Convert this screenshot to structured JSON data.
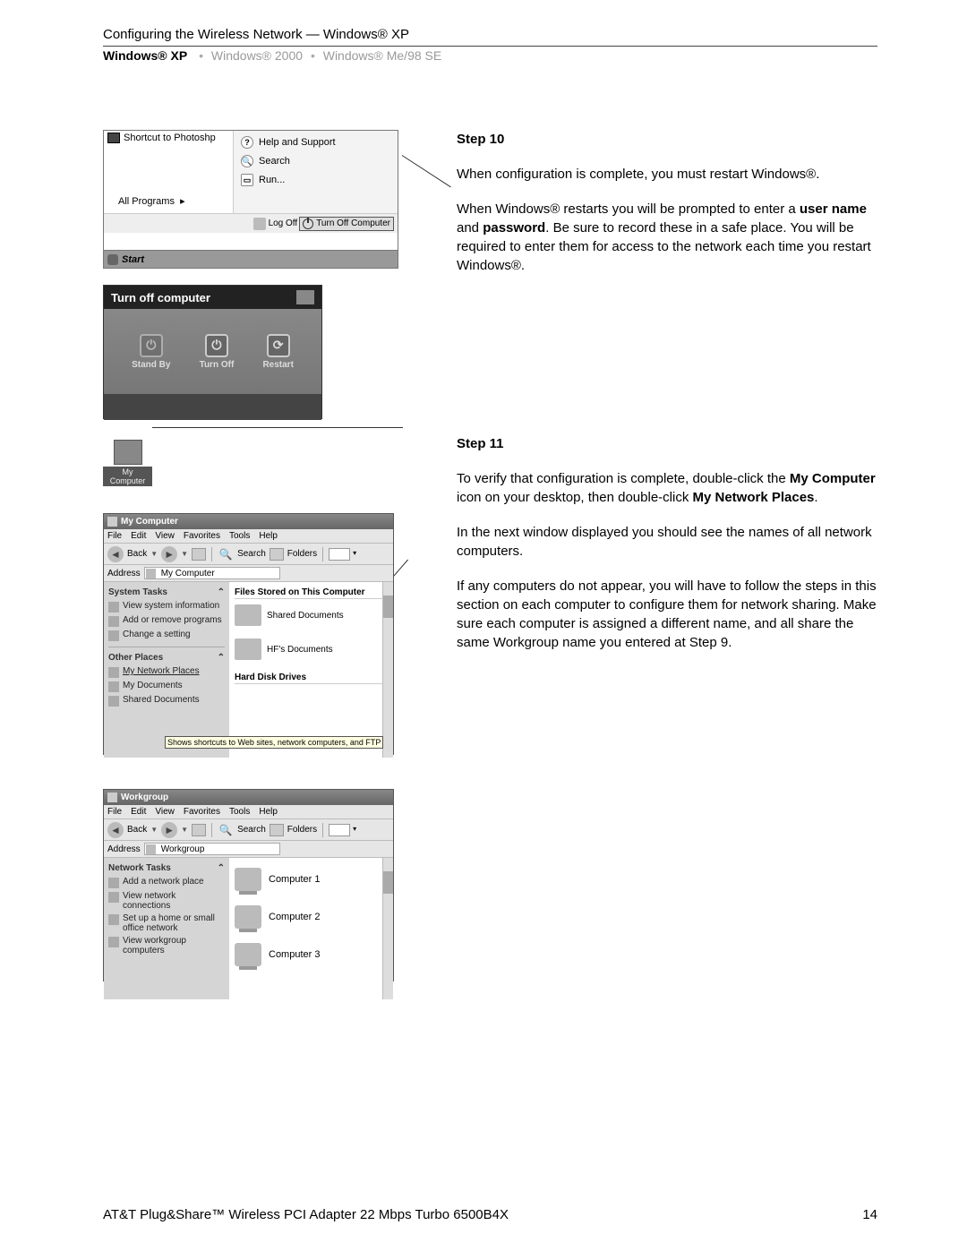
{
  "header": {
    "title": "Configuring the Wireless Network — Windows® XP",
    "os": [
      "Windows® XP",
      "Windows® 2000",
      "Windows® Me/98 SE"
    ]
  },
  "footer": {
    "left": "AT&T Plug&Share™ Wireless PCI Adapter 22 Mbps Turbo 6500B4X",
    "right": "14"
  },
  "shot1": {
    "shortcut": "Shortcut to Photoshp",
    "allprograms": "All Programs",
    "help": "Help and Support",
    "search": "Search",
    "run": "Run...",
    "logoff": "Log Off",
    "turnoff": "Turn Off Computer",
    "start": "Start"
  },
  "shot2": {
    "title": "Turn off computer",
    "standby": "Stand By",
    "turnoff": "Turn Off",
    "restart": "Restart"
  },
  "shot3": {
    "label": "My Computer"
  },
  "shot4": {
    "title": "My Computer",
    "menus": [
      "File",
      "Edit",
      "View",
      "Favorites",
      "Tools",
      "Help"
    ],
    "back": "Back",
    "search": "Search",
    "folders": "Folders",
    "addressLabel": "Address",
    "addressValue": "My Computer",
    "systemTasks": "System Tasks",
    "st": [
      "View system information",
      "Add or remove programs",
      "Change a setting"
    ],
    "otherPlaces": "Other Places",
    "op": [
      "My Network Places",
      "My Documents",
      "Shared Documents"
    ],
    "filesHeader": "Files Stored on This Computer",
    "sharedDocs": "Shared Documents",
    "hfDocs": "HF's Documents",
    "hddHeader": "Hard Disk Drives",
    "tooltip": "Shows shortcuts to Web sites, network computers, and FTP"
  },
  "shot5": {
    "title": "Workgroup",
    "menus": [
      "File",
      "Edit",
      "View",
      "Favorites",
      "Tools",
      "Help"
    ],
    "back": "Back",
    "search": "Search",
    "folders": "Folders",
    "addressLabel": "Address",
    "addressValue": "Workgroup",
    "netTasks": "Network Tasks",
    "nt": [
      "Add a network place",
      "View network connections",
      "Set up a home or small office network",
      "View workgroup computers"
    ],
    "computers": [
      "Computer 1",
      "Computer 2",
      "Computer 3"
    ]
  },
  "steps": {
    "s10": {
      "title": "Step 10",
      "p1": "When configuration is complete, you must restart Windows®.",
      "p2": "When Windows® restarts you will be prompted to enter a user name and password. Be sure to record these in a safe place. You will be required to enter them for access to the network each time you restart Windows®."
    },
    "s11": {
      "title": "Step 11",
      "p1": "To verify that configuration is complete, double-click the My Computer icon on your desktop, then double-click My Network Places.",
      "p2": "In the next window displayed you should see the names of all network computers.",
      "p3": "If any computers do not appear, you will have to follow the steps in this section on each computer to configure them for network sharing. Make sure each computer is assigned a different name, and all share the same Workgroup name you entered at Step 9."
    }
  }
}
